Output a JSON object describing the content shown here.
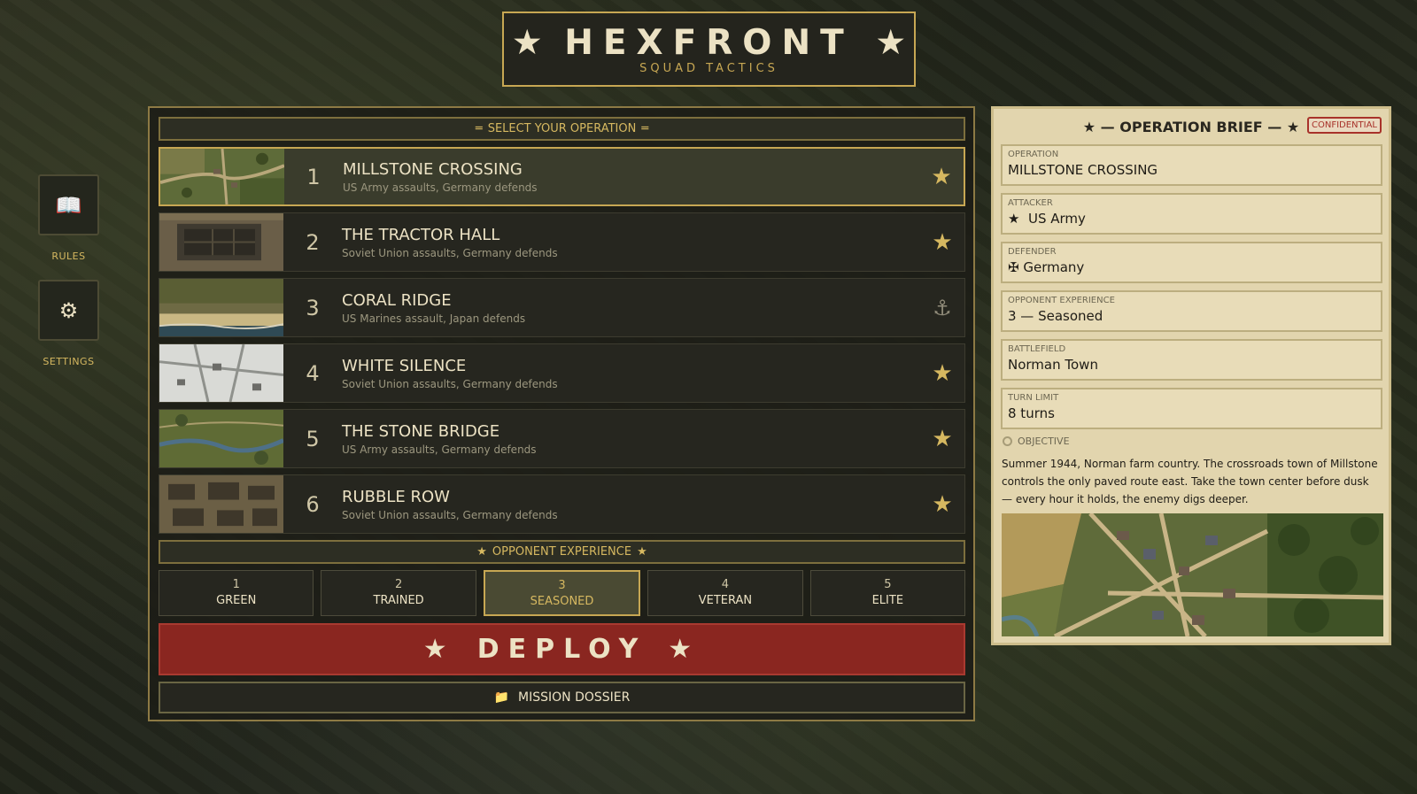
{
  "header": {
    "title": "HEXFRONT",
    "star": "★",
    "subtitle": "SQUAD TACTICS"
  },
  "sidebar": [
    {
      "icon": "📖",
      "label": "RULES",
      "icon_name": "book-icon"
    },
    {
      "icon": "⚙",
      "label": "SETTINGS",
      "icon_name": "gear-icon"
    }
  ],
  "operations": {
    "heading": "SELECT YOUR OPERATION",
    "items": [
      {
        "num": "1",
        "name": "MILLSTONE CROSSING",
        "desc": "US Army assaults, Germany defends",
        "icon": "★",
        "selected": true
      },
      {
        "num": "2",
        "name": "THE TRACTOR HALL",
        "desc": "Soviet Union assaults, Germany defends",
        "icon": "★"
      },
      {
        "num": "3",
        "name": "CORAL RIDGE",
        "desc": "US Marines assault, Japan defends",
        "icon": "⚓"
      },
      {
        "num": "4",
        "name": "WHITE SILENCE",
        "desc": "Soviet Union assaults, Germany defends",
        "icon": "★"
      },
      {
        "num": "5",
        "name": "THE STONE BRIDGE",
        "desc": "US Army assaults, Germany defends",
        "icon": "★"
      },
      {
        "num": "6",
        "name": "RUBBLE ROW",
        "desc": "Soviet Union assaults, Germany defends",
        "icon": "★"
      }
    ]
  },
  "experience": {
    "heading": "OPPONENT EXPERIENCE",
    "levels": [
      {
        "num": "1",
        "label": "GREEN"
      },
      {
        "num": "2",
        "label": "TRAINED"
      },
      {
        "num": "3",
        "label": "SEASONED",
        "selected": true
      },
      {
        "num": "4",
        "label": "VETERAN"
      },
      {
        "num": "5",
        "label": "ELITE"
      }
    ]
  },
  "actions": {
    "deploy_label": "DEPLOY",
    "dossier_icon": "📁",
    "dossier_label": "MISSION DOSSIER"
  },
  "brief": {
    "heading": "★ — OPERATION BRIEF — ★",
    "stamp": "CONFIDENTIAL",
    "operation_label": "OPERATION",
    "operation": "MILLSTONE CROSSING",
    "attacker_label": "ATTACKER",
    "attacker_icon": "★",
    "attacker": "US Army",
    "defender_label": "DEFENDER",
    "defender_icon": "✠",
    "defender": "Germany",
    "experience_label": "OPPONENT EXPERIENCE",
    "experience": "3 — Seasoned",
    "battlefield_label": "BATTLEFIELD",
    "battlefield": "Norman Town",
    "turn_label": "TURN LIMIT",
    "turns": "8 turns",
    "objective_label": "OBJECTIVE",
    "objective": "Summer 1944, Norman farm country. The crossroads town of Millstone controls the only paved route east. Take the town center before dusk — every hour it holds, the enemy digs deeper."
  },
  "colors": {
    "accent": "#c7a753",
    "deploy": "#8a2620",
    "brief_bg": "#e2d5ae"
  }
}
